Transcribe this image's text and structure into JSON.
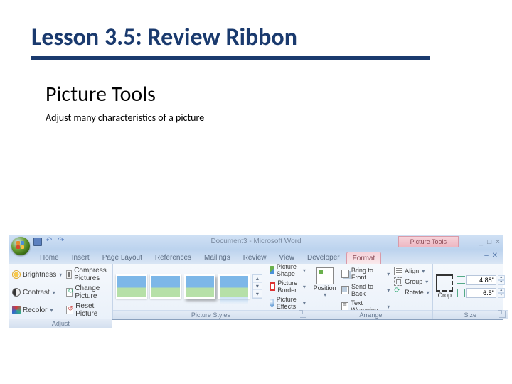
{
  "slide": {
    "title": "Lesson 3.5: Review Ribbon",
    "subtitle": "Picture Tools",
    "description": "Adjust many characteristics of a picture"
  },
  "word": {
    "doc_title": "Document3 - Microsoft Word",
    "context_tab_label": "Picture Tools",
    "tabs": {
      "home": "Home",
      "insert": "Insert",
      "page_layout": "Page Layout",
      "references": "References",
      "mailings": "Mailings",
      "review": "Review",
      "view": "View",
      "developer": "Developer",
      "format": "Format"
    },
    "groups": {
      "adjust": {
        "label": "Adjust",
        "brightness": "Brightness",
        "contrast": "Contrast",
        "recolor": "Recolor",
        "compress": "Compress Pictures",
        "change": "Change Picture",
        "reset": "Reset Picture"
      },
      "styles": {
        "label": "Picture Styles",
        "shape": "Picture Shape",
        "border": "Picture Border",
        "effects": "Picture Effects"
      },
      "arrange": {
        "label": "Arrange",
        "position": "Position",
        "bring_front": "Bring to Front",
        "send_back": "Send to Back",
        "text_wrap": "Text Wrapping",
        "align": "Align",
        "group": "Group",
        "rotate": "Rotate"
      },
      "size": {
        "label": "Size",
        "crop": "Crop",
        "height_val": "4.88\"",
        "width_val": "6.5\""
      }
    }
  }
}
